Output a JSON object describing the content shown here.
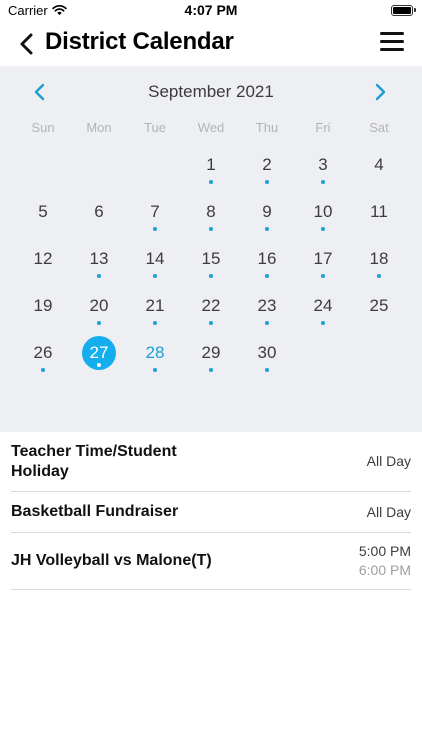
{
  "status": {
    "carrier": "Carrier",
    "time": "4:07 PM"
  },
  "nav": {
    "title": "District Calendar",
    "back_icon": "chevron-left-icon",
    "menu_icon": "hamburger-menu-icon"
  },
  "calendar": {
    "month_label": "September 2021",
    "accent_color": "#14aeee",
    "weekdays": [
      "Sun",
      "Mon",
      "Tue",
      "Wed",
      "Thu",
      "Fri",
      "Sat"
    ],
    "weeks": [
      [
        {
          "day": ""
        },
        {
          "day": ""
        },
        {
          "day": ""
        },
        {
          "day": "1",
          "dot": true
        },
        {
          "day": "2",
          "dot": true
        },
        {
          "day": "3",
          "dot": true
        },
        {
          "day": "4"
        }
      ],
      [
        {
          "day": "5"
        },
        {
          "day": "6"
        },
        {
          "day": "7",
          "dot": true
        },
        {
          "day": "8",
          "dot": true
        },
        {
          "day": "9",
          "dot": true
        },
        {
          "day": "10",
          "dot": true
        },
        {
          "day": "11"
        }
      ],
      [
        {
          "day": "12"
        },
        {
          "day": "13",
          "dot": true
        },
        {
          "day": "14",
          "dot": true
        },
        {
          "day": "15",
          "dot": true
        },
        {
          "day": "16",
          "dot": true
        },
        {
          "day": "17",
          "dot": true
        },
        {
          "day": "18",
          "dot": true
        }
      ],
      [
        {
          "day": "19"
        },
        {
          "day": "20",
          "dot": true
        },
        {
          "day": "21",
          "dot": true
        },
        {
          "day": "22",
          "dot": true
        },
        {
          "day": "23",
          "dot": true
        },
        {
          "day": "24",
          "dot": true
        },
        {
          "day": "25"
        }
      ],
      [
        {
          "day": "26",
          "dot": true
        },
        {
          "day": "27",
          "dot": true,
          "selected": true
        },
        {
          "day": "28",
          "dot": true,
          "today": true
        },
        {
          "day": "29",
          "dot": true
        },
        {
          "day": "30",
          "dot": true
        },
        {
          "day": ""
        },
        {
          "day": ""
        }
      ]
    ]
  },
  "events": [
    {
      "title": "Teacher Time/Student Holiday",
      "title_lines": [
        "Teacher Time/Student",
        "Holiday"
      ],
      "start": "All Day",
      "end": ""
    },
    {
      "title": "Basketball Fundraiser",
      "title_lines": [
        "Basketball Fundraiser"
      ],
      "start": "All Day",
      "end": ""
    },
    {
      "title": "JH Volleyball vs Malone(T)",
      "title_lines": [
        "JH Volleyball vs Malone(T)"
      ],
      "start": "5:00 PM",
      "end": "6:00 PM"
    }
  ]
}
